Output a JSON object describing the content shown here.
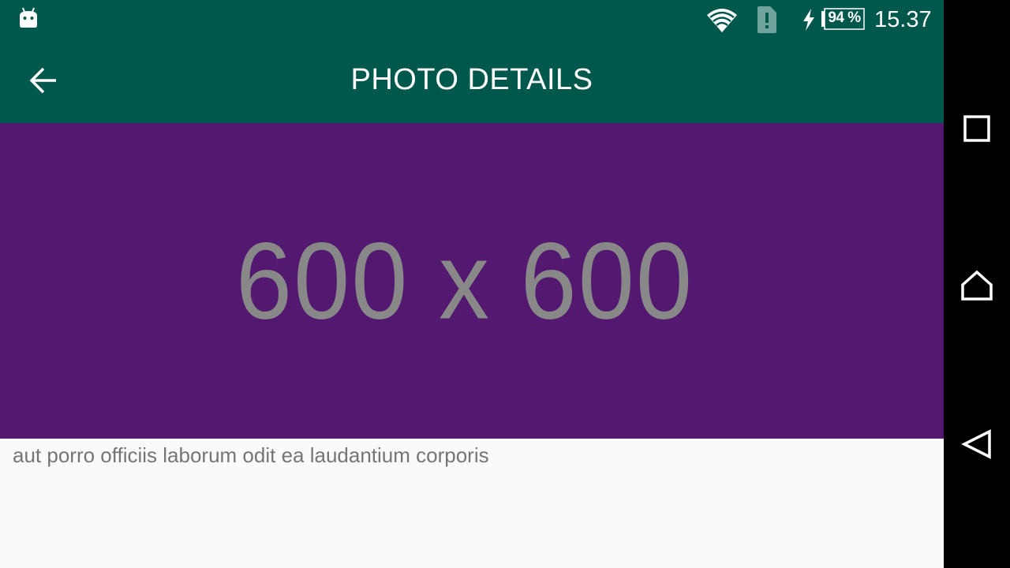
{
  "status_bar": {
    "battery_percent_text": "94 %",
    "time": "15.37",
    "icons": [
      "android-debug-icon",
      "wifi-icon",
      "sim-alert-icon",
      "charging-icon",
      "battery-icon"
    ]
  },
  "toolbar": {
    "title": "PHOTO DETAILS",
    "back_icon": "arrow-back-icon"
  },
  "photo": {
    "placeholder_text": "600 x 600",
    "background_color": "#53186f"
  },
  "photo_title": "aut porro officiis laborum odit ea laudantium corporis",
  "nav_bar": {
    "buttons": [
      "recents-icon",
      "home-icon",
      "back-icon"
    ]
  },
  "colors": {
    "primary": "#00574b",
    "photo_bg": "#53186f",
    "placeholder_text": "#888888",
    "body_text": "#757575"
  }
}
